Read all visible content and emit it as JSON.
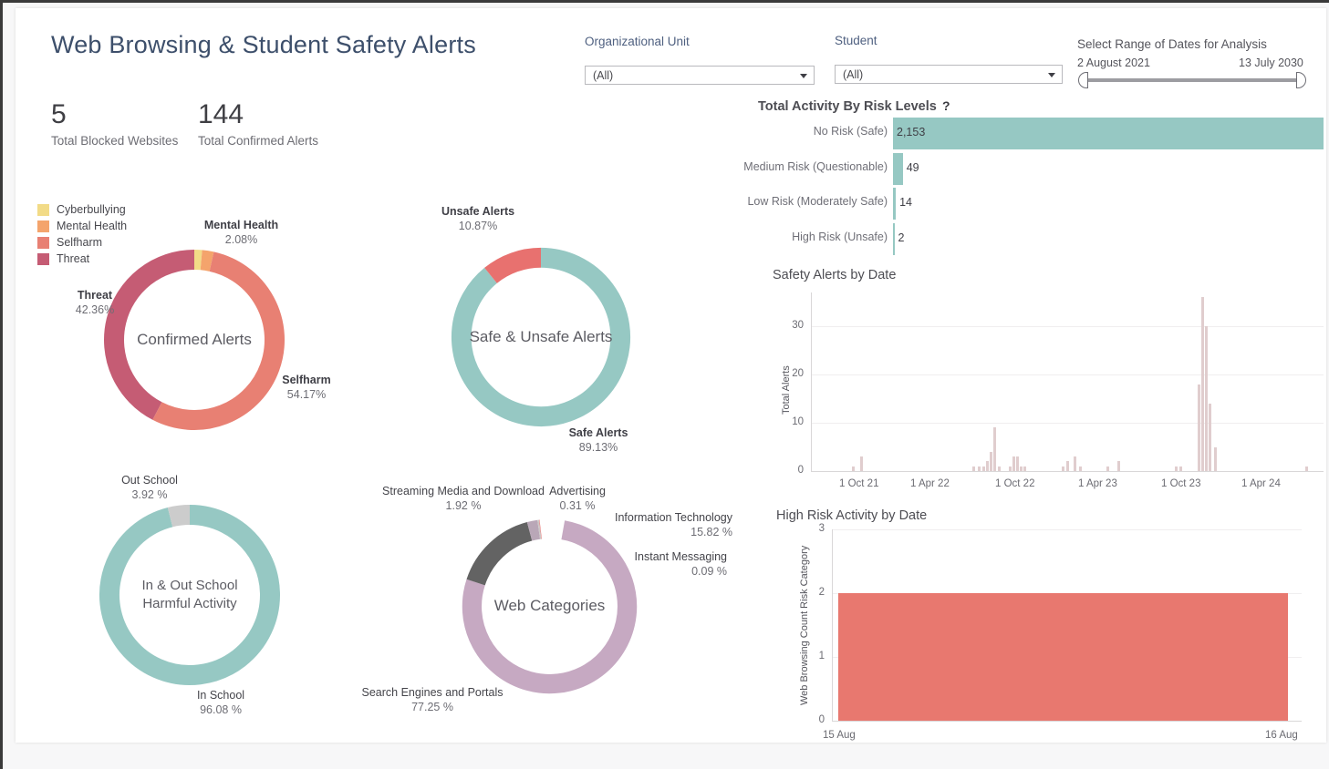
{
  "header": {
    "title": "Web Browsing & Student Safety Alerts",
    "kpis": [
      {
        "value": "5",
        "label": "Total Blocked Websites"
      },
      {
        "value": "144",
        "label": "Total Confirmed Alerts"
      }
    ]
  },
  "filters": {
    "org_unit": {
      "label": "Organizational Unit",
      "value": "(All)"
    },
    "student": {
      "label": "Student",
      "value": "(All)"
    },
    "date_range": {
      "label": "Select Range of Dates for Analysis",
      "start": "2 August 2021",
      "end": "13 July 2030"
    }
  },
  "risk_panel": {
    "title": "Total Activity By Risk Levels",
    "help_glyph": "?"
  },
  "charts": {
    "alerts_donut": {
      "center": "Confirmed Alerts"
    },
    "safety_donut": {
      "center": "Safe & Unsafe Alerts"
    },
    "school_donut": {
      "center_line1": "In & Out School",
      "center_line2": "Harmful Activity"
    },
    "category_donut": {
      "center": "Web Categories"
    },
    "alerts_by_date": {
      "title": "Safety Alerts by Date"
    },
    "high_risk": {
      "title": "High Risk Activity by Date"
    }
  },
  "chart_data": [
    {
      "type": "bar",
      "orientation": "horizontal",
      "title": "Total Activity By Risk Levels",
      "categories": [
        "No Risk (Safe)",
        "Medium Risk (Questionable)",
        "Low Risk (Moderately Safe)",
        "High Risk (Unsafe)"
      ],
      "values": [
        2153,
        49,
        14,
        2
      ],
      "value_labels": [
        "2,153",
        "49",
        "14",
        "2"
      ],
      "color": "#96c8c3",
      "xlim": [
        0,
        2153
      ],
      "grid": false,
      "legend": "none"
    },
    {
      "type": "pie",
      "variant": "donut",
      "title": "Confirmed Alerts",
      "center_label": "Confirmed Alerts",
      "legend": [
        "Cyberbullying",
        "Mental Health",
        "Selfharm",
        "Threat"
      ],
      "legend_position": "top-left",
      "slices": [
        {
          "name": "Cyberbullying",
          "percent": 1.39,
          "label": "",
          "color": "#f2db87"
        },
        {
          "name": "Mental Health",
          "percent": 2.08,
          "label": "Mental Health",
          "pct_text": "2.08%",
          "color": "#f4a46c"
        },
        {
          "name": "Selfharm",
          "percent": 54.17,
          "label": "Selfharm",
          "pct_text": "54.17%",
          "color": "#e88073"
        },
        {
          "name": "Threat",
          "percent": 42.36,
          "label": "Threat",
          "pct_text": "42.36%",
          "color": "#c55c74"
        }
      ]
    },
    {
      "type": "pie",
      "variant": "donut",
      "title": "Safe & Unsafe Alerts",
      "center_label": "Safe & Unsafe Alerts",
      "slices": [
        {
          "name": "Safe Alerts",
          "percent": 89.13,
          "label": "Safe Alerts",
          "pct_text": "89.13%",
          "color": "#96c8c3"
        },
        {
          "name": "Unsafe Alerts",
          "percent": 10.87,
          "label": "Unsafe Alerts",
          "pct_text": "10.87%",
          "color": "#e8716f"
        }
      ]
    },
    {
      "type": "pie",
      "variant": "donut",
      "title": "In & Out School Harmful Activity",
      "center_label": "In & Out School Harmful Activity",
      "slices": [
        {
          "name": "In School",
          "percent": 96.08,
          "label": "In School",
          "pct_text": "96.08 %",
          "color": "#96c8c3"
        },
        {
          "name": "Out School",
          "percent": 3.92,
          "label": "Out School",
          "pct_text": "3.92 %",
          "color": "#cccccc"
        }
      ]
    },
    {
      "type": "pie",
      "variant": "donut",
      "title": "Web Categories",
      "center_label": "Web Categories",
      "slices": [
        {
          "name": "Search Engines and Portals",
          "percent": 77.25,
          "label": "Search Engines and Portals",
          "pct_text": "77.25 %",
          "color": "#c6a9c2"
        },
        {
          "name": "Information Technology",
          "percent": 15.82,
          "label": "Information Technology",
          "pct_text": "15.82 %",
          "color": "#636363"
        },
        {
          "name": "Streaming Media and Download",
          "percent": 1.92,
          "label": "Streaming Media and Download",
          "pct_text": "1.92 %",
          "color": "#b9a7b7"
        },
        {
          "name": "Advertising",
          "percent": 0.31,
          "label": "Advertising",
          "pct_text": "0.31 %",
          "color": "#cdc7c6"
        },
        {
          "name": "Instant Messaging",
          "percent": 0.09,
          "label": "Instant Messaging",
          "pct_text": "0.09 %",
          "color": "#e8716f"
        }
      ]
    },
    {
      "type": "bar",
      "title": "Safety Alerts by Date",
      "ylabel": "Total Alerts",
      "xlabel": "",
      "ylim": [
        0,
        37
      ],
      "yticks": [
        0,
        10,
        20,
        30
      ],
      "xticks": [
        "1 Oct 21",
        "1 Apr 22",
        "1 Oct 22",
        "1 Apr 23",
        "1 Oct 23",
        "1 Apr 24"
      ],
      "bar_color": "#e0cdce",
      "grid": true,
      "points": [
        {
          "x": 8.0,
          "y": 1
        },
        {
          "x": 9.6,
          "y": 3
        },
        {
          "x": 31.5,
          "y": 1
        },
        {
          "x": 32.6,
          "y": 1
        },
        {
          "x": 33.4,
          "y": 1
        },
        {
          "x": 34.2,
          "y": 2
        },
        {
          "x": 34.9,
          "y": 4
        },
        {
          "x": 35.6,
          "y": 9
        },
        {
          "x": 36.5,
          "y": 1
        },
        {
          "x": 38.6,
          "y": 1
        },
        {
          "x": 39.3,
          "y": 3
        },
        {
          "x": 40.0,
          "y": 3
        },
        {
          "x": 40.8,
          "y": 1
        },
        {
          "x": 41.5,
          "y": 1
        },
        {
          "x": 49.0,
          "y": 1
        },
        {
          "x": 49.8,
          "y": 2
        },
        {
          "x": 51.2,
          "y": 3
        },
        {
          "x": 52.3,
          "y": 1
        },
        {
          "x": 57.6,
          "y": 1
        },
        {
          "x": 59.8,
          "y": 2
        },
        {
          "x": 71.0,
          "y": 1
        },
        {
          "x": 71.8,
          "y": 1
        },
        {
          "x": 75.4,
          "y": 18
        },
        {
          "x": 76.1,
          "y": 36
        },
        {
          "x": 76.8,
          "y": 30
        },
        {
          "x": 77.5,
          "y": 14
        },
        {
          "x": 78.6,
          "y": 5
        },
        {
          "x": 96.5,
          "y": 1
        }
      ]
    },
    {
      "type": "bar",
      "title": "High Risk Activity by Date",
      "ylabel": "Web Browsing Count Risk Category",
      "ylim": [
        0,
        3
      ],
      "yticks": [
        0,
        1,
        2,
        3
      ],
      "xticks": [
        "15 Aug",
        "16 Aug"
      ],
      "bar_color": "#e8786f",
      "values": [
        2
      ],
      "grid": true
    }
  ]
}
